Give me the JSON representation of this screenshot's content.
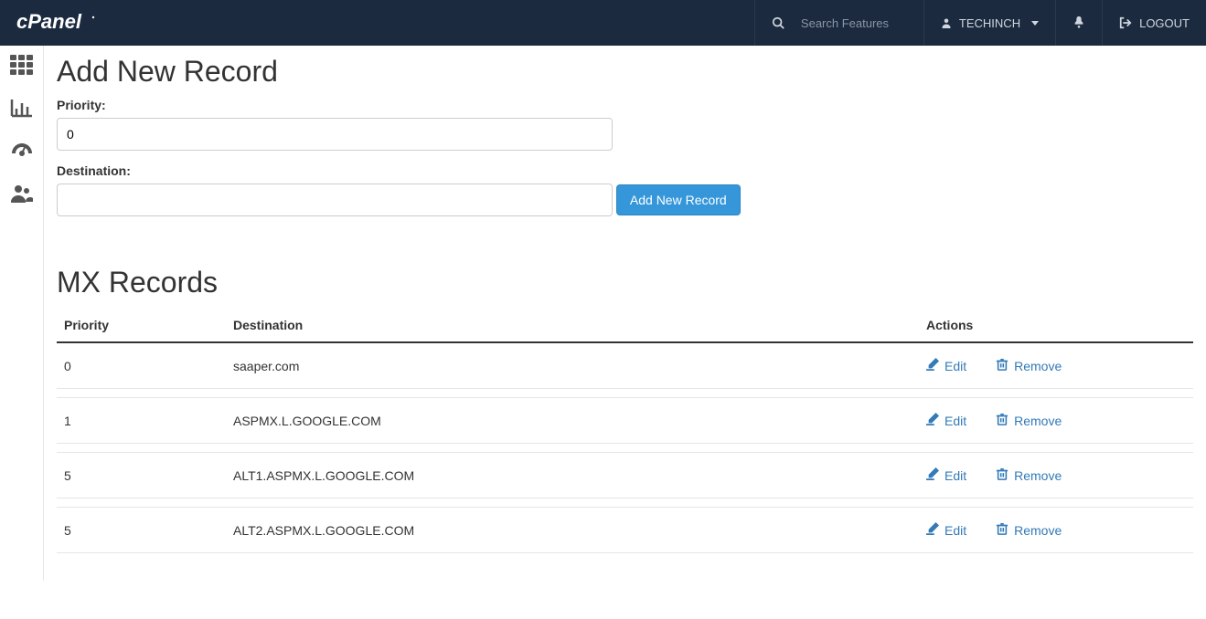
{
  "header": {
    "search_placeholder": "Search Features",
    "username": "TECHINCH",
    "logout_label": "LOGOUT"
  },
  "page": {
    "add_heading": "Add New Record",
    "priority_label": "Priority:",
    "priority_value": "0",
    "destination_label": "Destination:",
    "destination_value": "",
    "add_button_label": "Add New Record",
    "records_heading": "MX Records"
  },
  "table": {
    "columns": {
      "priority": "Priority",
      "destination": "Destination",
      "actions": "Actions"
    },
    "edit_label": "Edit",
    "remove_label": "Remove",
    "rows": [
      {
        "priority": "0",
        "destination": "saaper.com"
      },
      {
        "priority": "1",
        "destination": "ASPMX.L.GOOGLE.COM"
      },
      {
        "priority": "5",
        "destination": "ALT1.ASPMX.L.GOOGLE.COM"
      },
      {
        "priority": "5",
        "destination": "ALT2.ASPMX.L.GOOGLE.COM"
      }
    ]
  }
}
